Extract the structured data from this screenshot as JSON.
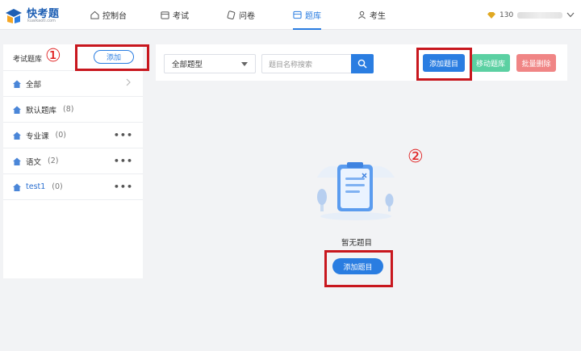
{
  "logo": {
    "name": "快考题",
    "sub": "kuaikaoti.com"
  },
  "nav": [
    {
      "label": "控制台",
      "icon": "home-icon"
    },
    {
      "label": "考试",
      "icon": "calendar-icon"
    },
    {
      "label": "问卷",
      "icon": "clipboard-icon"
    },
    {
      "label": "题库",
      "icon": "database-icon",
      "active": true
    },
    {
      "label": "考生",
      "icon": "user-icon"
    }
  ],
  "user": {
    "name": "130"
  },
  "sidebar": {
    "title": "考试题库",
    "add_label": "添加",
    "items": [
      {
        "label": "全部",
        "count": ""
      },
      {
        "label": "默认题库",
        "count": "(8)"
      },
      {
        "label": "专业课",
        "count": "(0)"
      },
      {
        "label": "语文",
        "count": "(2)"
      },
      {
        "label": "test1",
        "count": "(0)"
      }
    ],
    "more": "•••"
  },
  "toolbar": {
    "type_select": "全部题型",
    "search_placeholder": "题目名称搜索",
    "add_question": "添加题目",
    "move_bank": "移动题库",
    "batch_delete": "批量删除"
  },
  "empty": {
    "text": "暂无题目",
    "button": "添加题目"
  },
  "annotations": {
    "one": "①",
    "two": "②"
  },
  "colors": {
    "primary": "#2a7de1",
    "green": "#5bd0a2",
    "red": "#f08585",
    "highlight": "#c8171e"
  }
}
